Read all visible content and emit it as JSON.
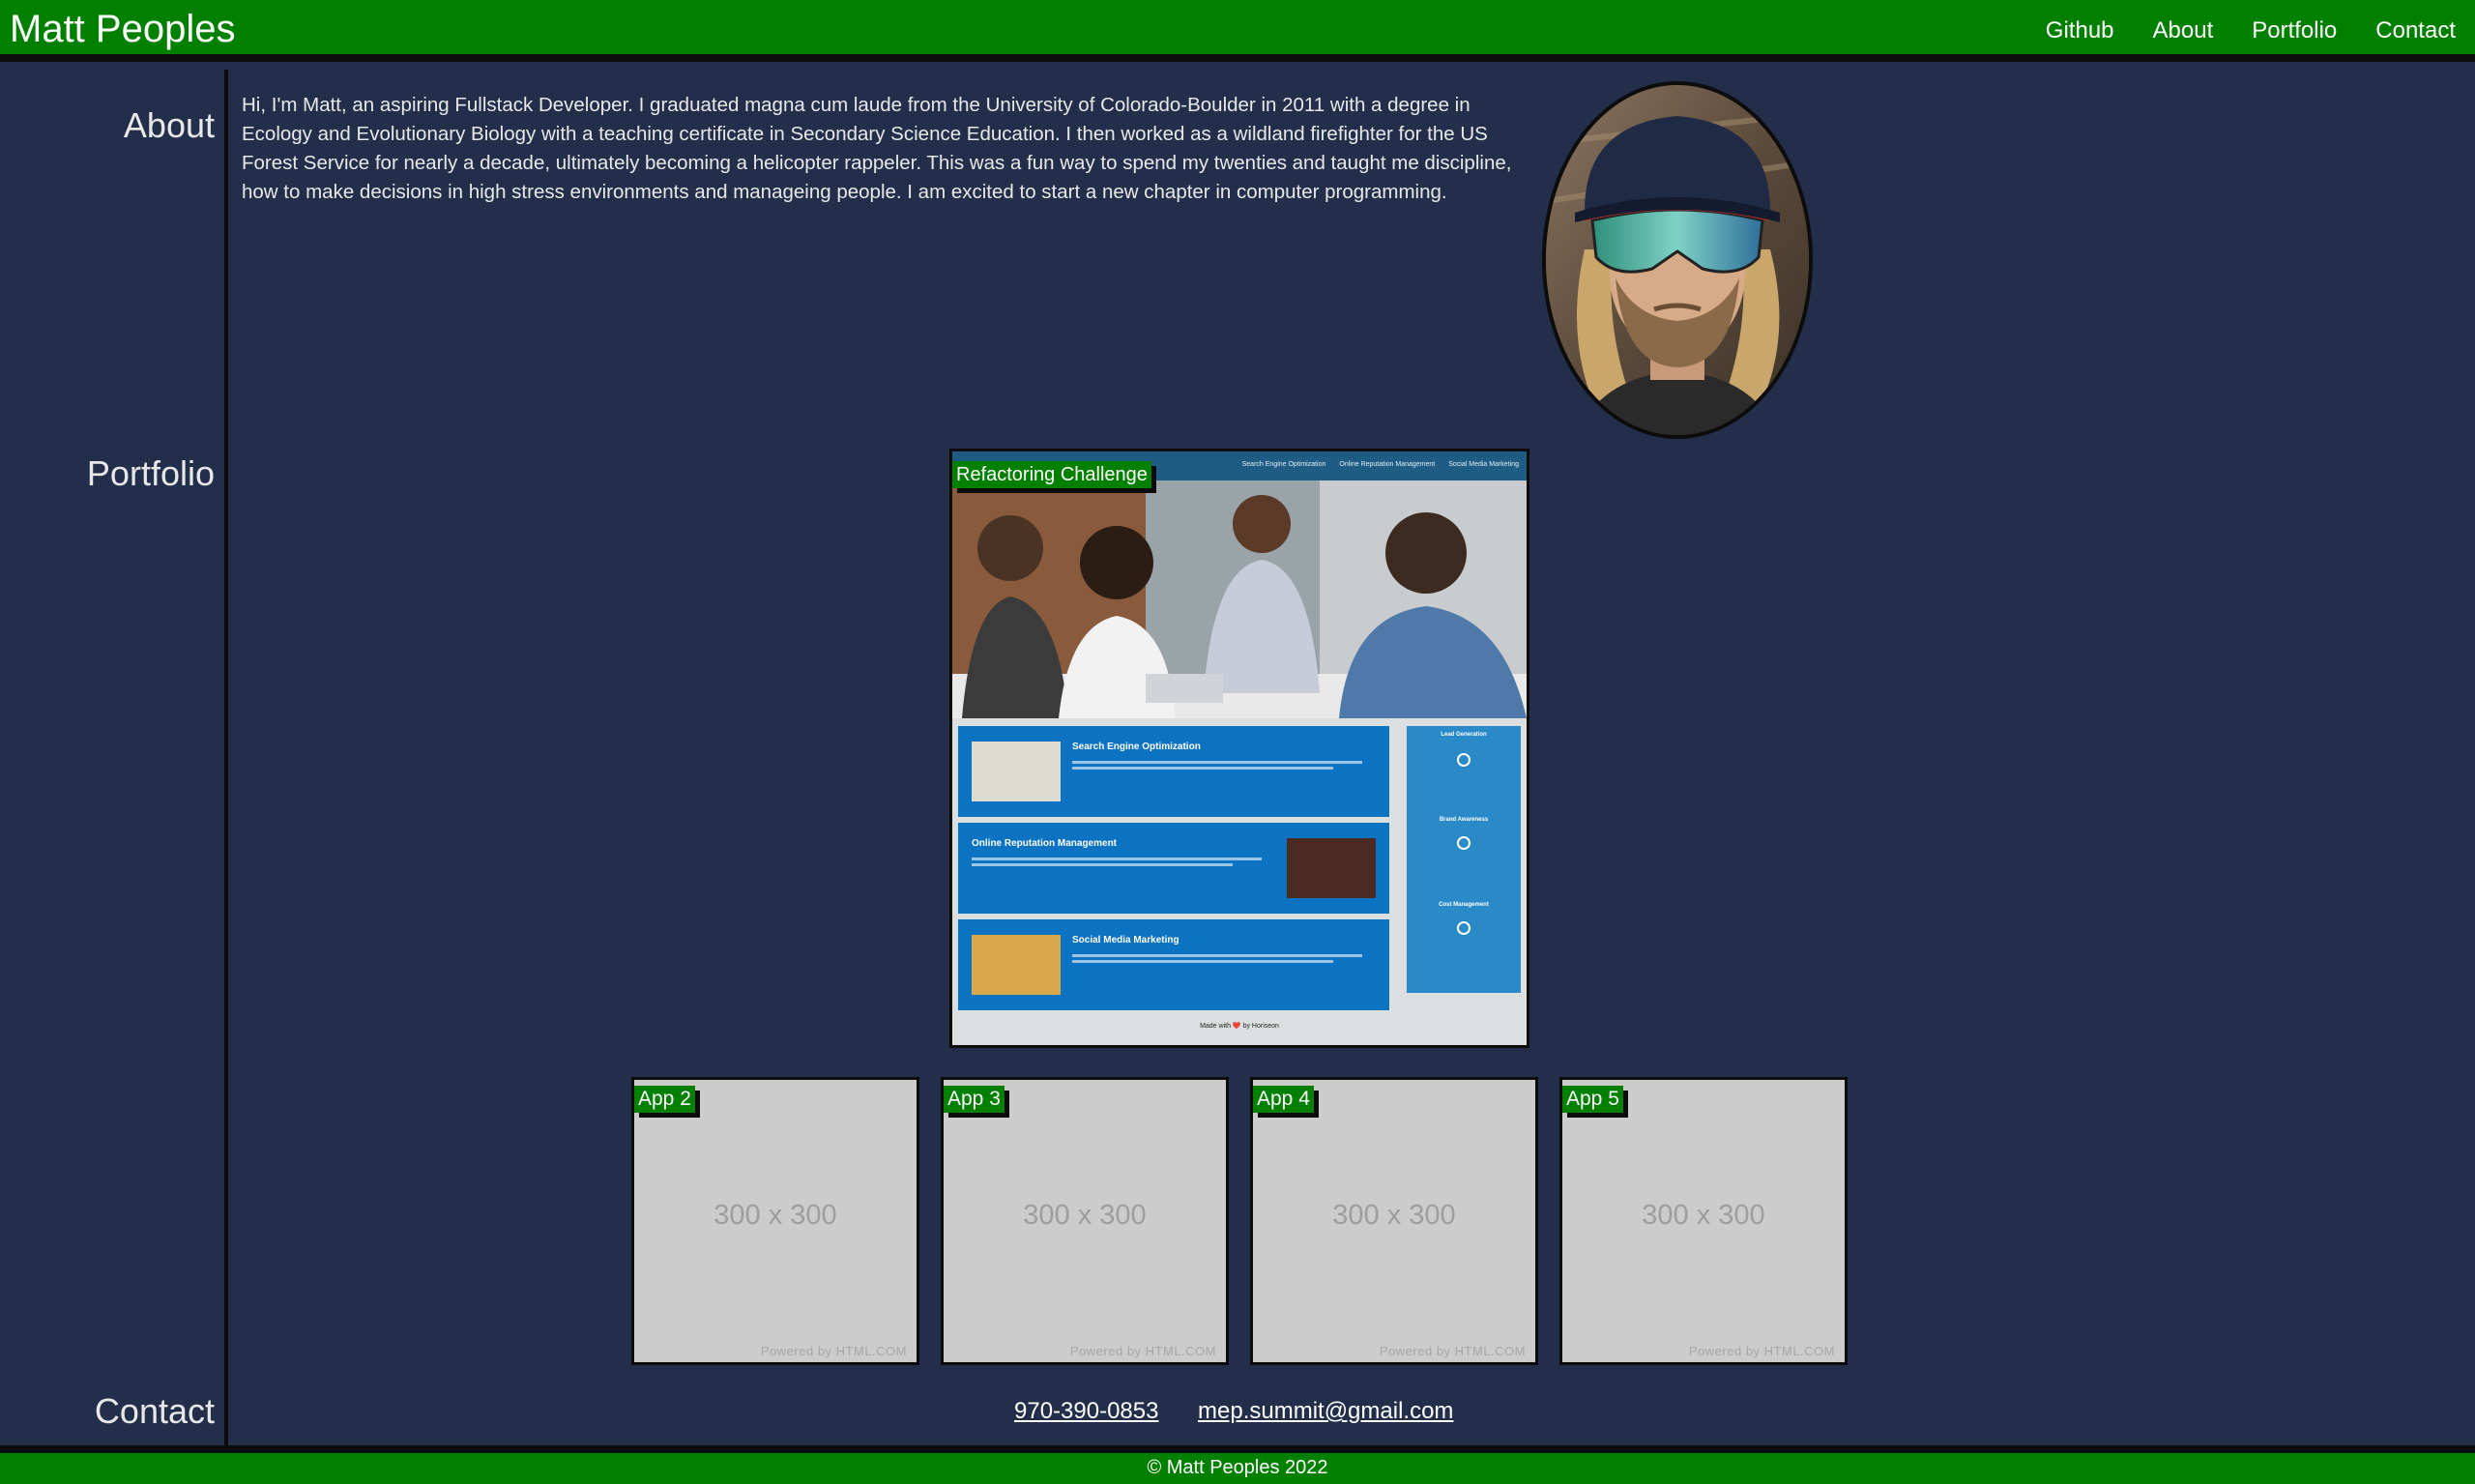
{
  "header": {
    "site_title": "Matt Peoples",
    "nav": [
      "Github",
      "About",
      "Portfolio",
      "Contact"
    ]
  },
  "sections": {
    "about": "About",
    "portfolio": "Portfolio",
    "contact": "Contact"
  },
  "about": {
    "text": "Hi, I'm Matt, an aspiring Fullstack Developer. I graduated magna cum laude from the University of Colorado-Boulder in 2011 with a degree in Ecology and Evolutionary Biology with a teaching certificate in Secondary Science Education. I then worked as a wildland firefighter for the US Forest Service for nearly a decade, ultimately becoming a helicopter rappeler. This was a fun way to spend my twenties and taught me discipline, how to make decisions in high stress environments and manageing people. I am excited to start a new chapter in computer programming."
  },
  "portfolio": {
    "featured": {
      "label": "Refactoring Challenge",
      "mock_nav": [
        "Search Engine Optimization",
        "Online Reputation Management",
        "Social Media Marketing"
      ],
      "mock_cards": [
        "Search Engine Optimization",
        "Online Reputation Management",
        "Social Media Marketing"
      ],
      "mock_benefits": [
        "Lead Generation",
        "Brand Awareness",
        "Cost Management"
      ],
      "mock_footer": "Made with ❤️ by Horiseon"
    },
    "apps": [
      {
        "label": "App 2",
        "placeholder": "300 x 300",
        "powered": "Powered by HTML.COM"
      },
      {
        "label": "App 3",
        "placeholder": "300 x 300",
        "powered": "Powered by HTML.COM"
      },
      {
        "label": "App 4",
        "placeholder": "300 x 300",
        "powered": "Powered by HTML.COM"
      },
      {
        "label": "App 5",
        "placeholder": "300 x 300",
        "powered": "Powered by HTML.COM"
      }
    ]
  },
  "contact": {
    "phone": "970-390-0853",
    "email": "mep.summit@gmail.com"
  },
  "footer": {
    "text": "© Matt Peoples 2022"
  },
  "colors": {
    "brand_green": "#018000",
    "background": "#222e4a",
    "border": "#0c0c0c"
  }
}
